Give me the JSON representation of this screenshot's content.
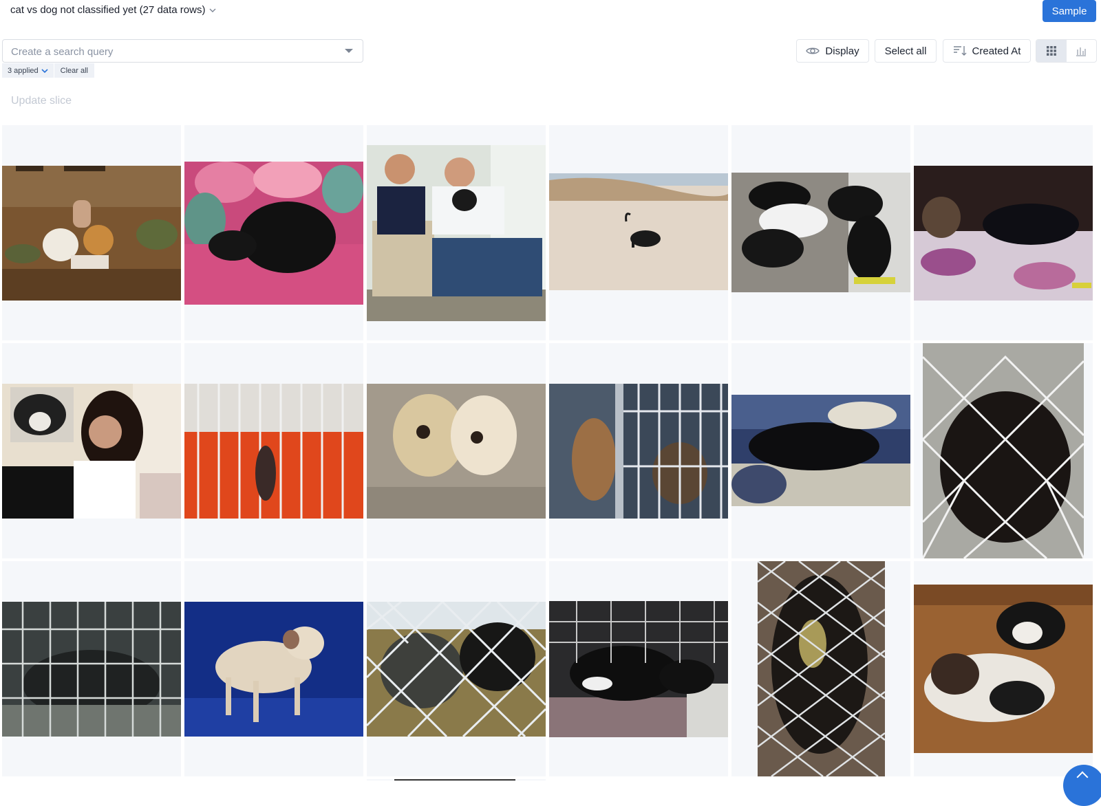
{
  "header": {
    "slice_title": "cat vs dog not classified yet (27 data rows)",
    "sample_label": "Sample"
  },
  "search": {
    "placeholder": "Create a search query",
    "applied_label": "3 applied",
    "clear_label": "Clear all"
  },
  "toolbar": {
    "display_label": "Display",
    "select_all_label": "Select all",
    "sort_label": "Created At",
    "view_modes": [
      "grid-view",
      "chart-view"
    ],
    "active_view": "grid-view"
  },
  "update_slice_label": "Update slice",
  "colors": {
    "accent": "#2a73d9",
    "cell_bg": "#f5f7fa",
    "muted_text": "#c3c9d3"
  },
  "gallery": {
    "visible_rows": 3,
    "columns": 6,
    "items": [
      {
        "subject": "girl on couch with two dogs"
      },
      {
        "subject": "black dog on pink pillow"
      },
      {
        "subject": "couple holding puppy"
      },
      {
        "subject": "black dog on beach"
      },
      {
        "subject": "puppies sleeping on mat"
      },
      {
        "subject": "dog and cat on flowered bedspread"
      },
      {
        "subject": "woman with dog photo inset"
      },
      {
        "subject": "dog in cage on orange floor"
      },
      {
        "subject": "two pekingese dogs"
      },
      {
        "subject": "dog behind cage bars"
      },
      {
        "subject": "black dog lying on blanket"
      },
      {
        "subject": "black dog behind chain-link fence"
      },
      {
        "subject": "dog inside wire crate"
      },
      {
        "subject": "scruffy white dog on blue"
      },
      {
        "subject": "dogs behind chain-link fence"
      },
      {
        "subject": "litter of puppies in pen"
      },
      {
        "subject": "puppy behind wire fence"
      },
      {
        "subject": "two small black and white dogs"
      }
    ]
  }
}
